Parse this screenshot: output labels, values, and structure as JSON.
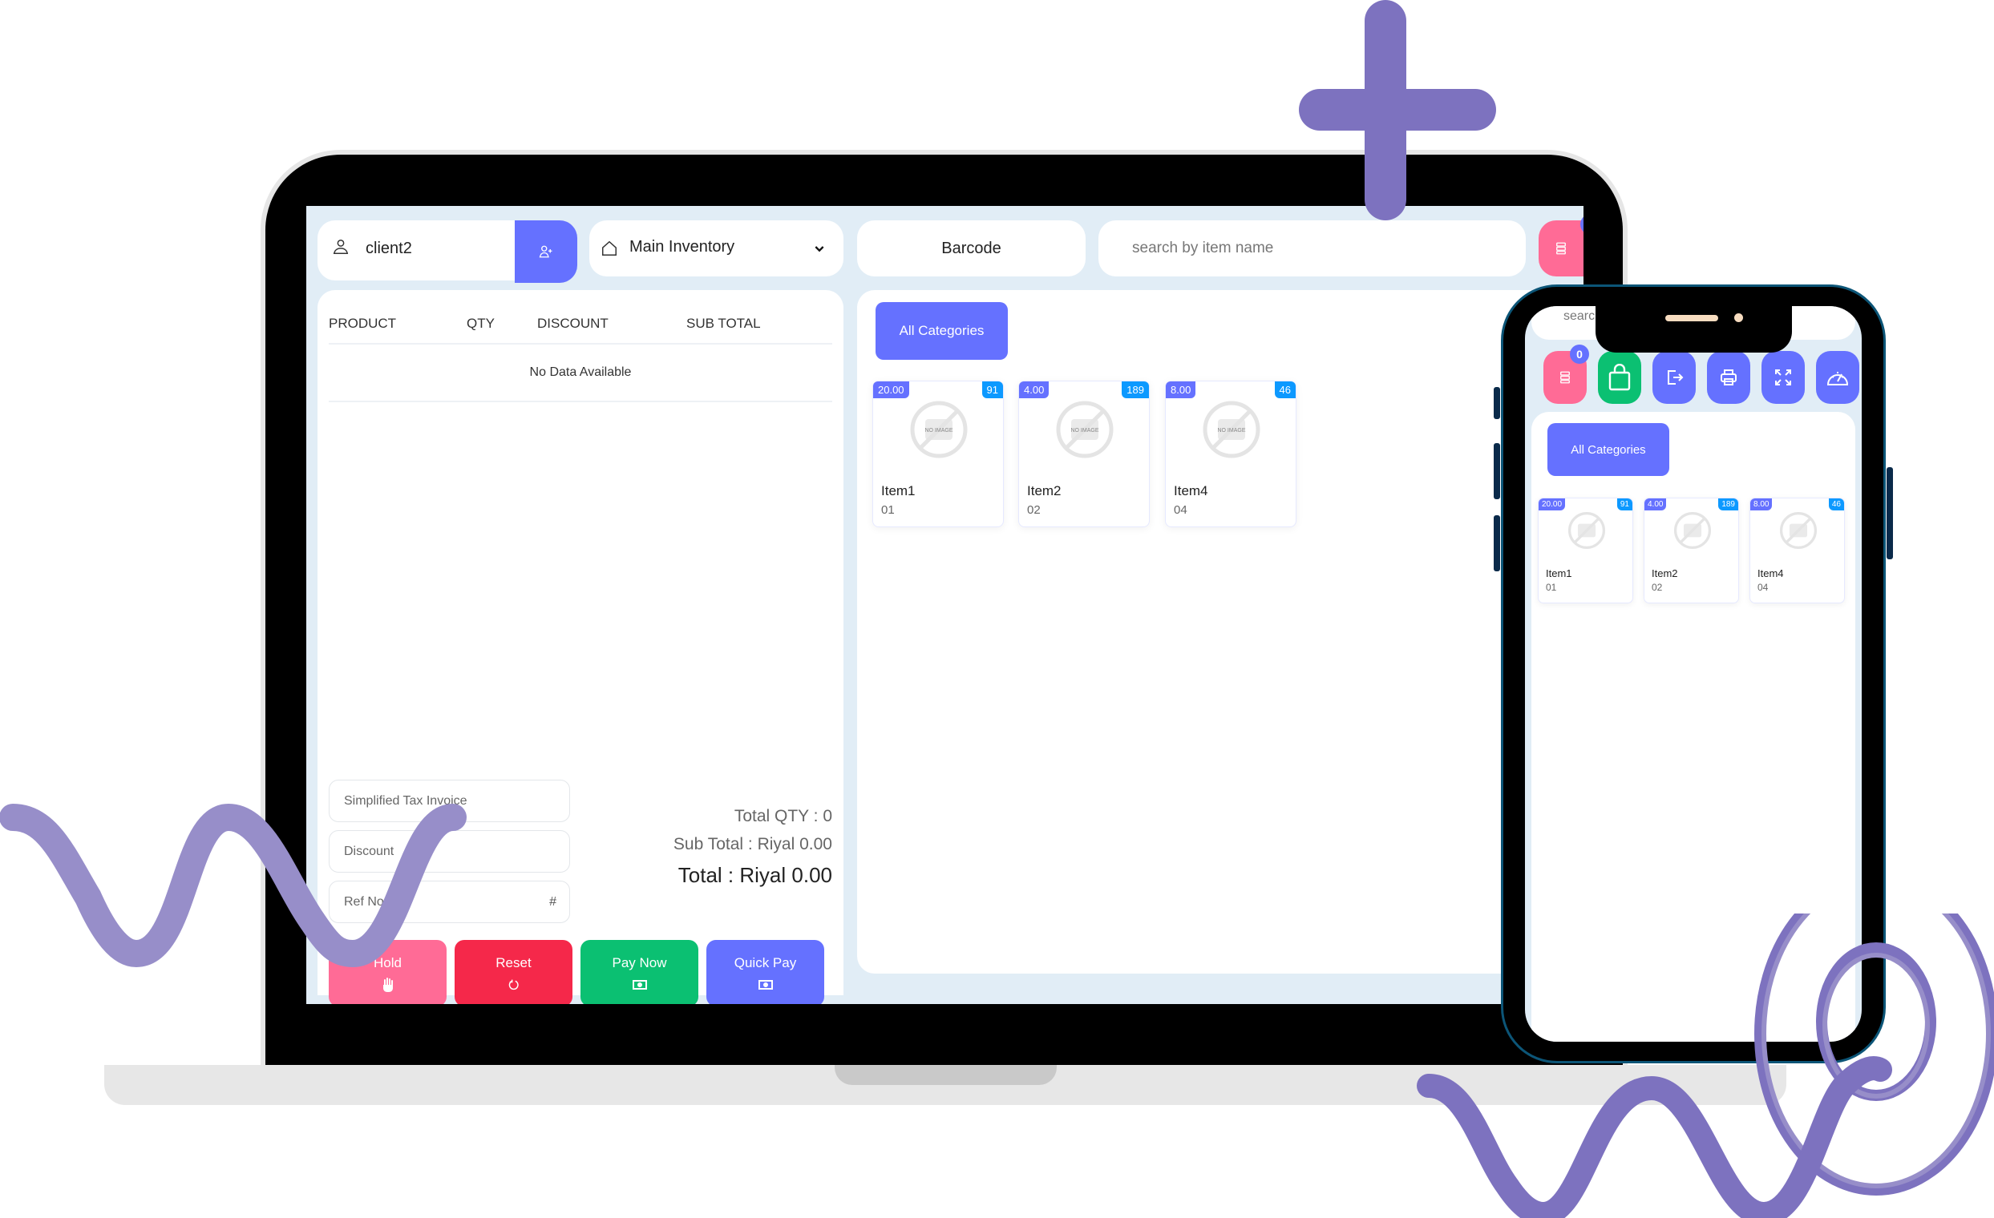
{
  "header": {
    "client_name": "client2",
    "inventory_label": "Main Inventory",
    "barcode_placeholder": "Barcode",
    "search_placeholder": "search by item name"
  },
  "cart": {
    "columns": [
      "PRODUCT",
      "QTY",
      "DISCOUNT",
      "SUB TOTAL"
    ],
    "empty_message": "No Data Available",
    "fields": {
      "invoice_type": "Simplified Tax Invoice",
      "discount_placeholder": "Discount",
      "ref_placeholder": "Ref No",
      "ref_suffix": "#"
    },
    "totals": {
      "total_qty": "Total QTY : 0",
      "sub_total": "Sub Total : Riyal 0.00",
      "total": "Total : Riyal 0.00"
    },
    "actions": [
      {
        "label": "Hold",
        "icon": "hand-icon",
        "color": "#ff6b96"
      },
      {
        "label": "Reset",
        "icon": "reset-icon",
        "color": "#f5284a"
      },
      {
        "label": "Pay Now",
        "icon": "cash-icon",
        "color": "#0bc072"
      },
      {
        "label": "Quick Pay",
        "icon": "cash-icon",
        "color": "#6571ff"
      }
    ]
  },
  "products_panel": {
    "category_button": "All Categories",
    "no_image_text": "NO IMAGE",
    "items": [
      {
        "name": "Item1",
        "code": "01",
        "price": "20.00",
        "stock": "91"
      },
      {
        "name": "Item2",
        "code": "02",
        "price": "4.00",
        "stock": "189"
      },
      {
        "name": "Item4",
        "code": "04",
        "price": "8.00",
        "stock": "46"
      }
    ]
  },
  "phone": {
    "search_placeholder_visible": "searc",
    "held_count": "0",
    "toolbar_icons": [
      "held-orders-icon",
      "shopping-bag-icon",
      "logout-icon",
      "printer-icon",
      "fullscreen-icon",
      "dashboard-icon"
    ],
    "category_button": "All Categories"
  },
  "colors": {
    "primary": "#6571ff",
    "pink": "#ff6b96",
    "red": "#f5284a",
    "green": "#0bc072",
    "stock_blue": "#0d99ff",
    "screen_bg": "#e1edf6",
    "decoration_purple": "#7d72bf"
  }
}
